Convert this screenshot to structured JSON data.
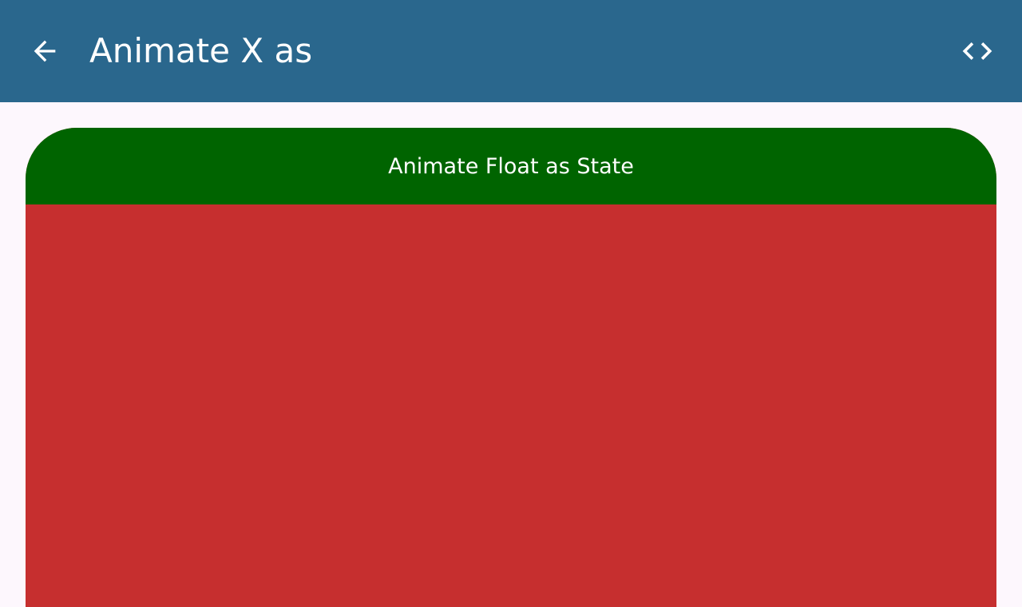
{
  "app_bar": {
    "title": "Animate X as",
    "back_icon": "arrow-back-icon",
    "code_icon": "code-icon",
    "background": "#2a678d"
  },
  "card": {
    "header_title": "Animate Float as State",
    "header_color": "#006400",
    "body_color": "#c62f2f"
  },
  "page": {
    "background": "#fdf7fd"
  }
}
